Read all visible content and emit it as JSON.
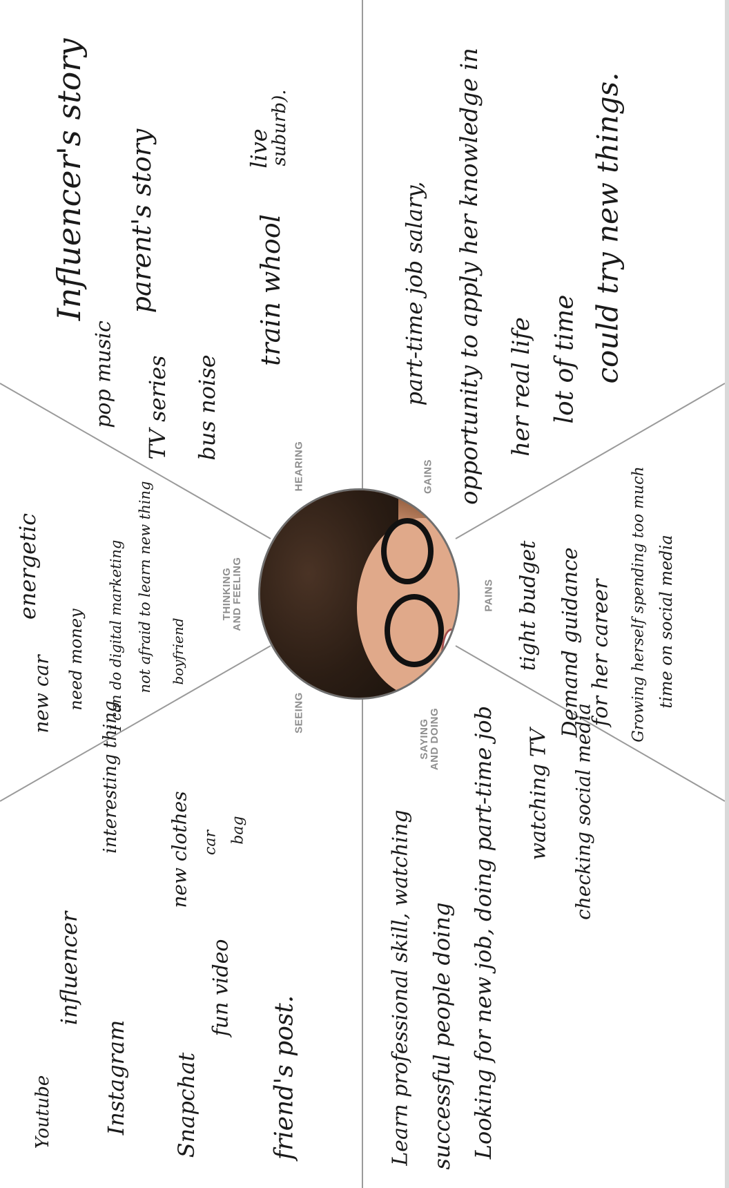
{
  "sections": {
    "hearing": "HEARING",
    "gains": "GAINS",
    "pains": "PAINS",
    "saying_doing": "SAYING\nAND DOING",
    "thinking_feeling": "THINKING\nAND FEELING",
    "seeing": "SEEING"
  },
  "hearing_notes": [
    "Influencer's story",
    "parent's story",
    "pop music",
    "TV series",
    "bus noise",
    "train whool",
    "live",
    "suburb)."
  ],
  "gains_notes": [
    "part-time job salary,",
    "opportunity to apply her knowledge in",
    "her real life",
    "lot of time",
    "could try new things."
  ],
  "pains_notes": [
    "tight budget",
    "Demand guidance",
    "for her career",
    "Growing herself spending too much",
    "time on social media"
  ],
  "thinking_notes": [
    "energetic",
    "new car",
    "need money",
    "I can do digital marketing",
    "not afraid to learn new thing",
    "boyfriend"
  ],
  "seeing_notes": [
    "Youtube",
    "influencer",
    "interesting thing",
    "Instagram",
    "new clothes",
    "car",
    "bag",
    "Snapchat",
    "fun video",
    "friend's post."
  ],
  "saying_notes": [
    "Learn professional skill, watching",
    "successful people doing",
    "Looking for new job, doing part-time job",
    "watching TV",
    "checking social media"
  ]
}
